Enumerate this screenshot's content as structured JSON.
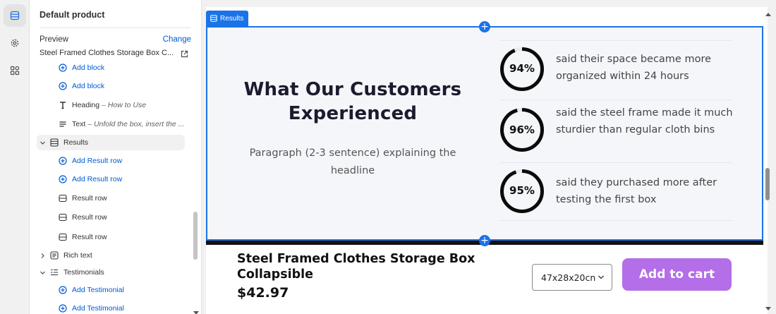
{
  "rail": {
    "items": [
      {
        "icon": "sections-icon",
        "active": true
      },
      {
        "icon": "gear-icon",
        "active": false
      },
      {
        "icon": "apps-icon",
        "active": false
      }
    ]
  },
  "sidebar": {
    "title": "Default product",
    "preview_label": "Preview",
    "change_link": "Change",
    "product_name": "Steel Framed Clothes Storage Box C...",
    "tree": [
      {
        "label": "Add block",
        "type": "add"
      },
      {
        "label": "Add block",
        "type": "add"
      },
      {
        "label": "Heading",
        "sub": "– How to Use",
        "type": "heading"
      },
      {
        "label": "Text",
        "sub": "– Unfold the box, insert the ...",
        "type": "text"
      },
      {
        "label": "Results",
        "type": "section"
      },
      {
        "label": "Add Result row",
        "type": "add"
      },
      {
        "label": "Add Result row",
        "type": "add"
      },
      {
        "label": "Result row",
        "type": "block"
      },
      {
        "label": "Result row",
        "type": "block"
      },
      {
        "label": "Result row",
        "type": "block"
      },
      {
        "label": "Rich text",
        "type": "section"
      },
      {
        "label": "Testimonials",
        "type": "section"
      },
      {
        "label": "Add Testimonial",
        "type": "add"
      },
      {
        "label": "Add Testimonial",
        "type": "add"
      }
    ]
  },
  "canvas": {
    "section_tag": "Results",
    "heading": "What Our Customers Experienced",
    "paragraph": "Paragraph (2-3 sentence) explaining the headline",
    "stats": [
      {
        "value": "94%",
        "percent": 94,
        "text": "said their space became more organized within 24 hours"
      },
      {
        "value": "96%",
        "percent": 96,
        "text": "said the steel frame made it much sturdier than regular cloth bins"
      },
      {
        "value": "95%",
        "percent": 95,
        "text": "said they purchased more after testing the first box"
      }
    ],
    "sticky_cart": {
      "title": "Steel Framed Clothes Storage Box Collapsible",
      "price": "$42.97",
      "variant": "47x28x20cn",
      "button": "Add to cart"
    }
  },
  "colors": {
    "accent": "#1a73e8",
    "link": "#005bd3",
    "cart_button": "#b46ee8"
  }
}
